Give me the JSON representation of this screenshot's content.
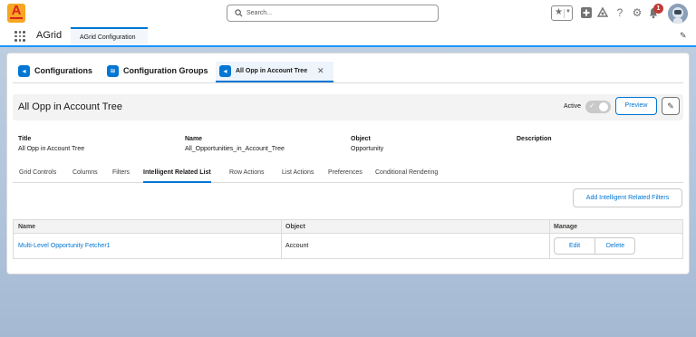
{
  "header": {
    "search_placeholder": "Search...",
    "notification_count": "1",
    "icons": [
      "star-icon",
      "chevron-down-icon",
      "add-icon",
      "trailhead-icon",
      "help-icon",
      "gear-icon",
      "bell-icon"
    ]
  },
  "nav": {
    "app_name": "AGrid",
    "tab_label": "AGrid Configuration"
  },
  "tabs": [
    {
      "label": "Configurations",
      "icon": "config-icon"
    },
    {
      "label": "Configuration Groups",
      "icon": "stack-icon"
    },
    {
      "label": "All Opp in Account Tree",
      "icon": "config-icon",
      "active": true
    }
  ],
  "record": {
    "title": "All Opp in Account Tree",
    "active_label": "Active",
    "active": true,
    "preview_label": "Preview",
    "fields": [
      {
        "label": "Title",
        "value": "All Opp in Account Tree"
      },
      {
        "label": "Name",
        "value": "All_Opportunities_in_Account_Tree"
      },
      {
        "label": "Object",
        "value": "Opportunity"
      },
      {
        "label": "Description",
        "value": ""
      }
    ]
  },
  "subtabs": [
    "Grid Controls",
    "Columns",
    "Filters",
    "Intelligent Related List",
    "Row Actions",
    "List Actions",
    "Preferences",
    "Conditional Rendering"
  ],
  "active_subtab": "Intelligent Related List",
  "add_button_label": "Add Intelligent Related Filters",
  "table": {
    "headers": [
      "Name",
      "Object",
      "Manage"
    ],
    "rows": [
      {
        "name": "Multi-Level Opportunity Fetcher1",
        "object": "Account",
        "edit": "Edit",
        "delete": "Delete"
      }
    ]
  },
  "colors": {
    "brand": "#0176d3",
    "background_band": "#b0c4dc"
  }
}
